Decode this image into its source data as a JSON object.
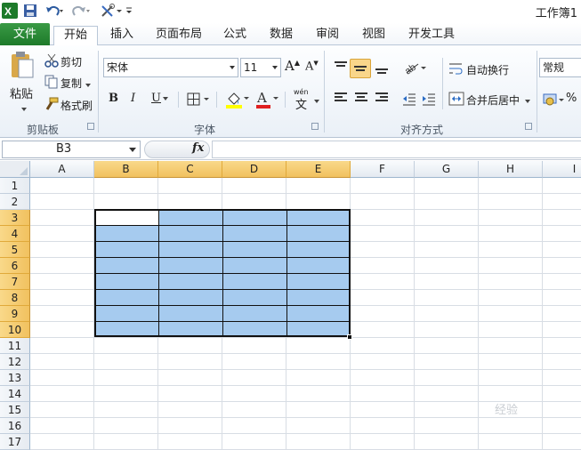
{
  "qat": {
    "undo_icon": "undo-icon",
    "redo_icon": "redo-icon"
  },
  "app_title": "工作簿1",
  "tabs": [
    {
      "label": "文件"
    },
    {
      "label": "开始"
    },
    {
      "label": "插入"
    },
    {
      "label": "页面布局"
    },
    {
      "label": "公式"
    },
    {
      "label": "数据"
    },
    {
      "label": "审阅"
    },
    {
      "label": "视图"
    },
    {
      "label": "开发工具"
    }
  ],
  "ribbon": {
    "clipboard": {
      "paste": "粘贴",
      "cut": "剪切",
      "copy": "复制",
      "format_painter": "格式刷",
      "group_label": "剪贴板"
    },
    "font": {
      "font_name": "宋体",
      "font_size": "11",
      "bold": "B",
      "italic": "I",
      "underline": "U",
      "grow_font": "A",
      "shrink_font": "A",
      "font_color": "A",
      "wen": "wén",
      "wen_char": "文",
      "group_label": "字体"
    },
    "alignment": {
      "wrap_text": "自动换行",
      "merge_center": "合并后居中",
      "group_label": "对齐方式"
    },
    "number": {
      "format": "常规"
    }
  },
  "formula_bar": {
    "name_box": "B3",
    "fx_label": "fx",
    "formula": ""
  },
  "grid": {
    "columns": [
      "A",
      "B",
      "C",
      "D",
      "E",
      "F",
      "G",
      "H",
      "I"
    ],
    "rows": [
      "1",
      "2",
      "3",
      "4",
      "5",
      "6",
      "7",
      "8",
      "9",
      "10",
      "11",
      "12",
      "13",
      "14",
      "15",
      "16",
      "17"
    ],
    "selected_range": "B3:E10",
    "active_cell": "B3"
  },
  "colors": {
    "file_tab": "#1d7a2a",
    "selection": "#a6cbef",
    "header_selected": "#f1c15f"
  },
  "watermark": "经验"
}
